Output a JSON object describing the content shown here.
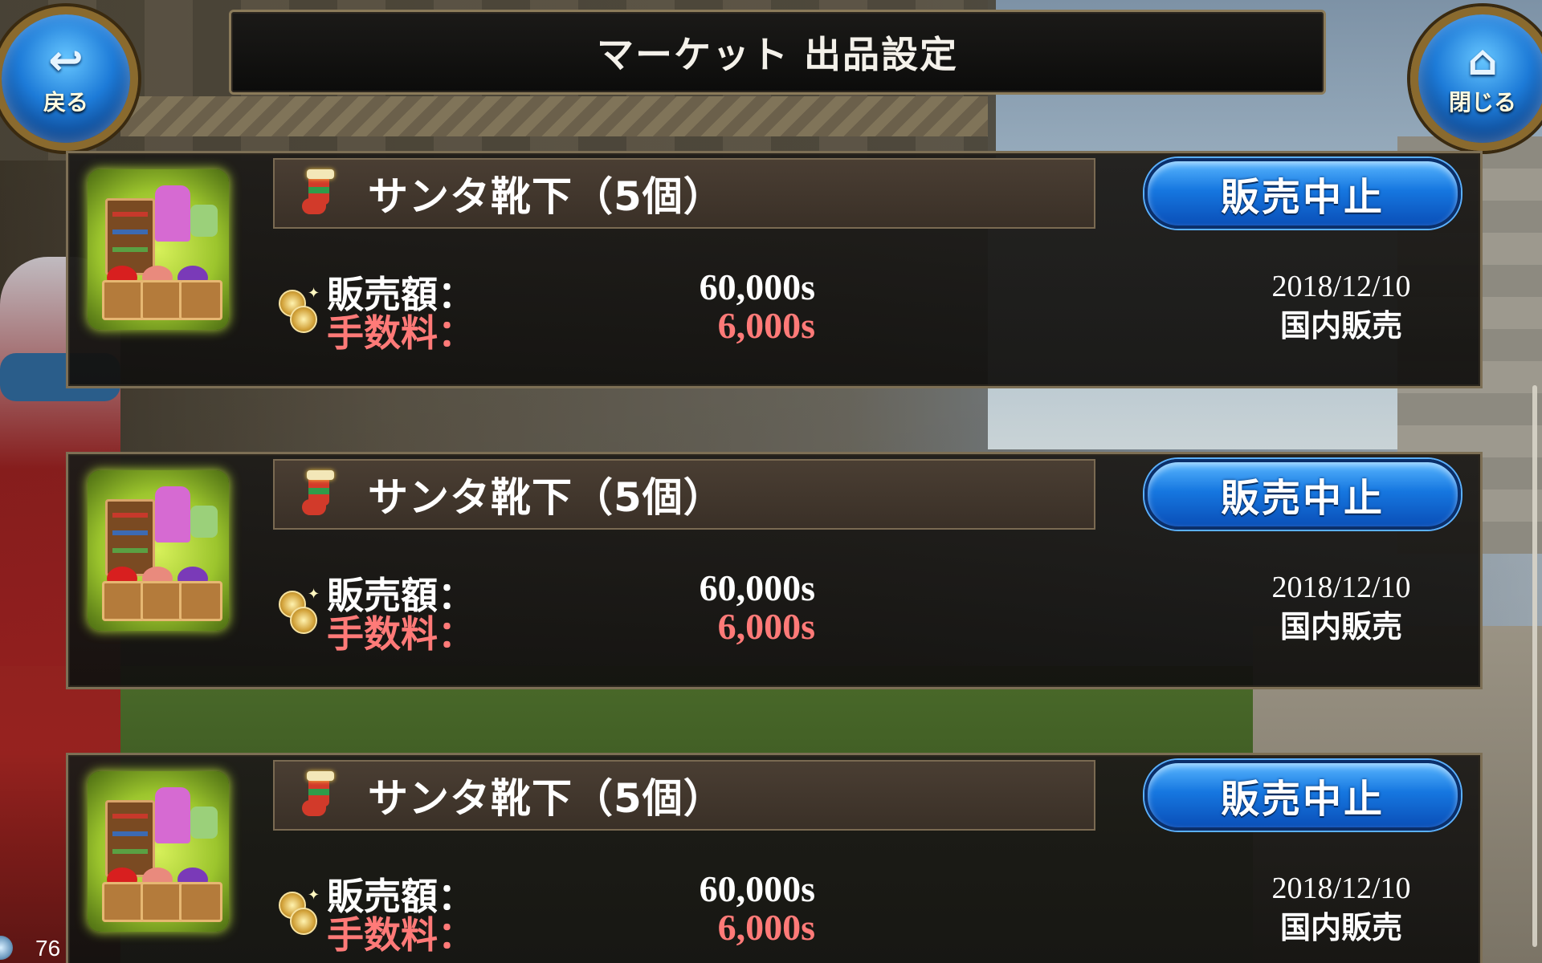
{
  "header": {
    "title": "マーケット 出品設定",
    "back_label": "戻る",
    "close_label": "閉じる",
    "back_icon": "↩",
    "close_icon": "⌂"
  },
  "listings": [
    {
      "item_name": "サンタ靴下（5個）",
      "cancel_label": "販売中止",
      "sale_label": "販売額：",
      "sale_value": "60,000s",
      "fee_label": "手数料：",
      "fee_value": "6,000s",
      "date": "2018/12/10",
      "market": "国内販売"
    },
    {
      "item_name": "サンタ靴下（5個）",
      "cancel_label": "販売中止",
      "sale_label": "販売額：",
      "sale_value": "60,000s",
      "fee_label": "手数料：",
      "fee_value": "6,000s",
      "date": "2018/12/10",
      "market": "国内販売"
    },
    {
      "item_name": "サンタ靴下（5個）",
      "cancel_label": "販売中止",
      "sale_label": "販売額：",
      "sale_value": "60,000s",
      "fee_label": "手数料：",
      "fee_value": "6,000s",
      "date": "2018/12/10",
      "market": "国内販売"
    }
  ],
  "status": {
    "fps": "76"
  },
  "colors": {
    "accent_blue": "#1677e0",
    "fee_red": "#ff7a78",
    "panel_bg": "#1e1c19",
    "frame_gold": "#8b7b5a"
  },
  "icons": {
    "back": "back-arrow-icon",
    "close": "home-icon",
    "item": "santa-stocking-icon",
    "price": "coin-icon"
  }
}
